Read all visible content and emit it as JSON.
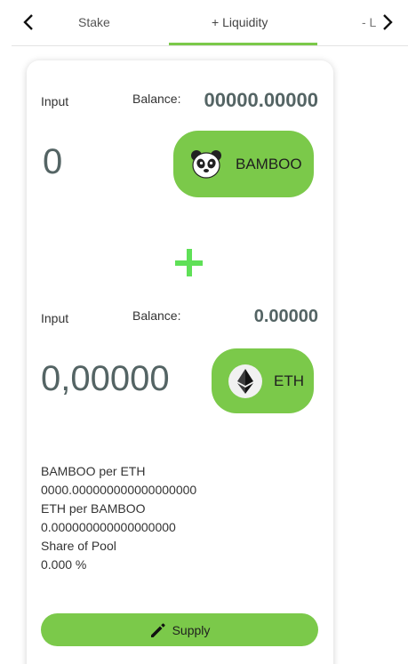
{
  "tabs": {
    "prev_icon": "chevron-left-icon",
    "next_icon": "chevron-right-icon",
    "items": [
      {
        "label": "Stake"
      },
      {
        "label": "+ Liquidity"
      },
      {
        "label": "- L"
      }
    ],
    "active_index": 1
  },
  "input_a": {
    "label": "Input",
    "balance_label": "Balance:",
    "balance_value": "00000.00000",
    "amount": "0",
    "token": {
      "symbol": "BAMBOO",
      "icon": "panda-icon"
    }
  },
  "plus_icon": "plus-icon",
  "input_b": {
    "label": "Input",
    "balance_label": "Balance:",
    "balance_value": "0.00000",
    "amount": "0,00000",
    "token": {
      "symbol": "ETH",
      "icon": "ethereum-icon"
    }
  },
  "pool_info": {
    "bamboo_per_eth_label": "BAMBOO per ETH",
    "bamboo_per_eth_value": "0000.000000000000000000",
    "eth_per_bamboo_label": "ETH per BAMBOO",
    "eth_per_bamboo_value": "0.000000000000000000",
    "share_label": "Share of Pool",
    "share_value": "0.000 %"
  },
  "supply_button": {
    "label": "Supply",
    "icon": "pencil-icon"
  },
  "colors": {
    "accent": "#7bc94a",
    "plus": "#5fe057",
    "value_text": "#546464"
  }
}
